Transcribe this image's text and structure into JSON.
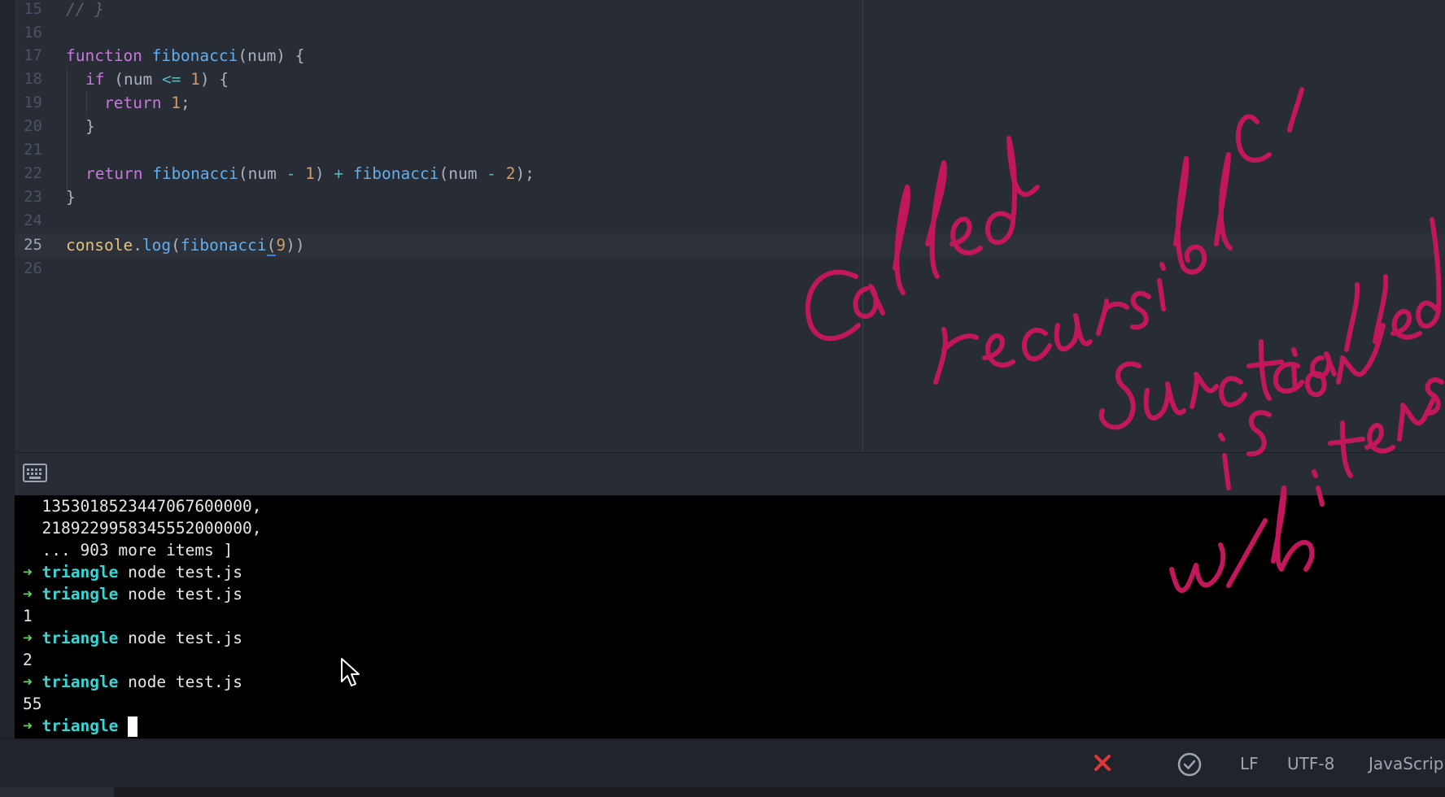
{
  "editor": {
    "line_numbers": [
      "15",
      "16",
      "17",
      "18",
      "19",
      "20",
      "21",
      "22",
      "23",
      "24",
      "25",
      "26"
    ],
    "active_line_number": "25",
    "code": {
      "l15": {
        "comment": "// }"
      },
      "l17": {
        "kw": "function",
        "name": "fibonacci",
        "rest": "(num) {"
      },
      "l18": {
        "kw": "if",
        "p1": " (num ",
        "op": "<=",
        "sp": " ",
        "num": "1",
        "p2": ") {"
      },
      "l19": {
        "kw": "return",
        "sp": " ",
        "num": "1",
        "p": ";"
      },
      "l20": {
        "text": "}"
      },
      "l22": {
        "kw": "return",
        "sp": " ",
        "fn1": "fibonacci",
        "p1": "(num ",
        "op1": "-",
        "sp2": " ",
        "n1": "1",
        "p2": ") ",
        "op2": "+",
        "sp3": " ",
        "fn2": "fibonacci",
        "p3": "(num ",
        "op3": "-",
        "sp4": " ",
        "n2": "2",
        "p4": ");"
      },
      "l23": {
        "text": "}"
      },
      "l25": {
        "obj": "console",
        "dot": ".",
        "method": "log",
        "p1": "(",
        "fn": "fibonacci",
        "p2": "(",
        "num": "9",
        "p3": "))"
      }
    }
  },
  "terminal": {
    "lines": [
      {
        "text": "  1353018523447067600000,"
      },
      {
        "text": "  2189229958345552000000,"
      },
      {
        "text": "  ... 903 more items ]"
      },
      {
        "arrow": "➜",
        "cwd": "triangle",
        "cmd": "node test.js"
      },
      {
        "arrow": "➜",
        "cwd": "triangle",
        "cmd": "node test.js"
      },
      {
        "text": "1"
      },
      {
        "arrow": "➜",
        "cwd": "triangle",
        "cmd": "node test.js"
      },
      {
        "text": "2"
      },
      {
        "arrow": "➜",
        "cwd": "triangle",
        "cmd": "node test.js"
      },
      {
        "text": "55"
      },
      {
        "arrow": "➜",
        "cwd": "triangle",
        "cmd": ""
      }
    ]
  },
  "statusbar": {
    "line_ending": "LF",
    "encoding": "UTF-8",
    "grammar": "JavaScrip"
  },
  "annotation": {
    "color": "#c2185b",
    "text_lines": [
      "Called",
      "recursible",
      "function",
      "is called",
      "w/h items"
    ]
  },
  "icons": {
    "terminal_toggle": "keyboard-icon",
    "errors": "x-icon",
    "git": "check-circle-icon",
    "mouse": "arrow-pointer-icon"
  },
  "colors": {
    "editor_bg": "#282c34",
    "keyword": "#c678dd",
    "function": "#61afef",
    "number": "#d19a66",
    "prompt_arrow": "#5fd35f",
    "prompt_cwd": "#3ad6d6",
    "error": "#e0363a"
  }
}
